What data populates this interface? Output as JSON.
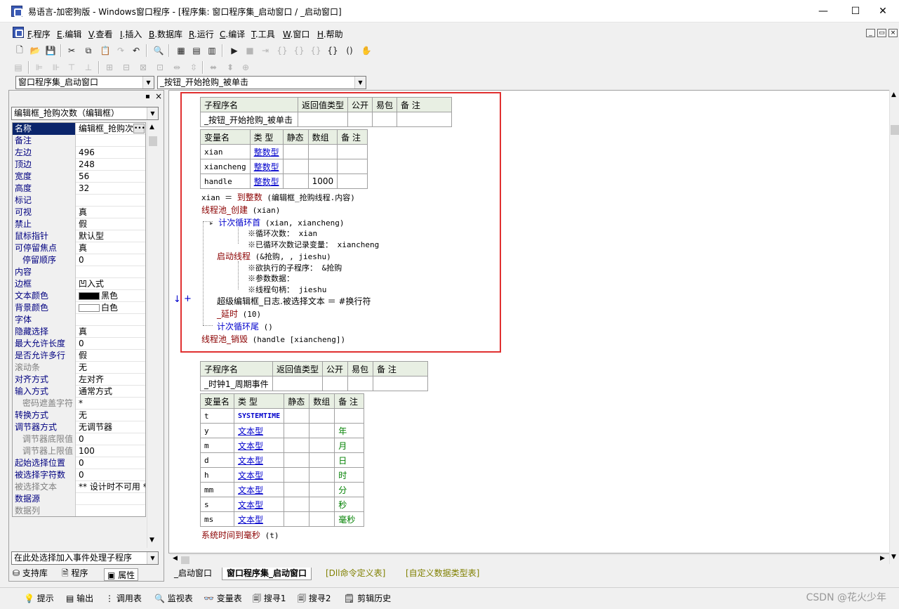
{
  "window": {
    "title": "易语言-加密狗版 - Windows窗口程序 - [程序集: 窗口程序集_启动窗口 / _启动窗口]",
    "min": "—",
    "max": "☐",
    "close": "✕"
  },
  "menu": [
    {
      "key": "F",
      "label": ".程序"
    },
    {
      "key": "E",
      "label": ".编辑"
    },
    {
      "key": "V",
      "label": ".查看"
    },
    {
      "key": "I",
      "label": ".插入"
    },
    {
      "key": "B",
      "label": ".数据库"
    },
    {
      "key": "R",
      "label": ".运行"
    },
    {
      "key": "C",
      "label": ".编译"
    },
    {
      "key": "T",
      "label": ".工具"
    },
    {
      "key": "W",
      "label": ".窗口"
    },
    {
      "key": "H",
      "label": ".帮助"
    }
  ],
  "mdi": {
    "min": "_",
    "restore": "▭",
    "close": "×"
  },
  "toolbar": {
    "assembly_combo": "窗口程序集_启动窗口",
    "sub_combo": "_按钮_开始抢购_被单击"
  },
  "left_panel": {
    "pin": "▪",
    "close": "×",
    "component_combo": "编辑框_抢购次数（编辑框）",
    "properties": [
      {
        "name": "名称",
        "value": "编辑框_抢购次数"
      },
      {
        "name": "备注",
        "value": ""
      },
      {
        "name": "左边",
        "value": "496"
      },
      {
        "name": "顶边",
        "value": "248"
      },
      {
        "name": "宽度",
        "value": "56"
      },
      {
        "name": "高度",
        "value": "32"
      },
      {
        "name": "标记",
        "value": ""
      },
      {
        "name": "可视",
        "value": "真"
      },
      {
        "name": "禁止",
        "value": "假"
      },
      {
        "name": "鼠标指针",
        "value": "默认型"
      },
      {
        "name": "可停留焦点",
        "value": "真"
      },
      {
        "name": "停留顺序",
        "value": "0"
      },
      {
        "name": "内容",
        "value": ""
      },
      {
        "name": "边框",
        "value": "凹入式"
      },
      {
        "name": "文本颜色",
        "value": "黑色"
      },
      {
        "name": "背景颜色",
        "value": "白色"
      },
      {
        "name": "字体",
        "value": ""
      },
      {
        "name": "隐藏选择",
        "value": "真"
      },
      {
        "name": "最大允许长度",
        "value": "0"
      },
      {
        "name": "是否允许多行",
        "value": "假"
      },
      {
        "name": "滚动条",
        "value": "无"
      },
      {
        "name": "对齐方式",
        "value": "左对齐"
      },
      {
        "name": "输入方式",
        "value": "通常方式"
      },
      {
        "name": "密码遮盖字符",
        "value": "*"
      },
      {
        "name": "转换方式",
        "value": "无"
      },
      {
        "name": "调节器方式",
        "value": "无调节器"
      },
      {
        "name": "调节器底限值",
        "value": "0"
      },
      {
        "name": "调节器上限值",
        "value": "100"
      },
      {
        "name": "起始选择位置",
        "value": "0"
      },
      {
        "name": "被选择字符数",
        "value": "0"
      },
      {
        "name": "被选择文本",
        "value": "** 设计时不可用 **"
      },
      {
        "name": "数据源",
        "value": ""
      },
      {
        "name": "数据列",
        "value": ""
      }
    ],
    "event_combo": "在此处选择加入事件处理子程序",
    "tabs": [
      "支持库",
      "程序",
      "属性"
    ]
  },
  "editor": {
    "sub1": {
      "headers": [
        "子程序名",
        "返回值类型",
        "公开",
        "易包",
        "备 注"
      ],
      "name": "_按钮_开始抢购_被单击",
      "var_headers": [
        "变量名",
        "类 型",
        "静态",
        "数组",
        "备 注"
      ],
      "vars": [
        {
          "name": "xian",
          "type": "整数型",
          "arr": ""
        },
        {
          "name": "xiancheng",
          "type": "整数型",
          "arr": ""
        },
        {
          "name": "handle",
          "type": "整数型",
          "arr": "1000"
        }
      ],
      "lines": {
        "l1a": "xian ＝ ",
        "l1b": "到整数",
        "l1c": " (编辑框_抢购线程.内容)",
        "l2a": "线程池_创建",
        "l2b": " (xian)",
        "l3a": "计次循环首",
        "l3b": " (xian, xiancheng)",
        "l4": "※循环次数： xian",
        "l5": "※已循环次数记录变量： xiancheng",
        "l6a": "启动线程",
        "l6b": " (&抢购, , jieshu)",
        "l7": "※欲执行的子程序： &抢购",
        "l8": "※参数数据：",
        "l9": "※线程句柄： jieshu",
        "l10": "超级编辑框_日志.被选择文本 ＝ #换行符",
        "l11a": "_延时",
        "l11b": " (10)",
        "l12a": "计次循环尾",
        "l12b": " ()",
        "l13a": "线程池_销毁",
        "l13b": " (handle [xiancheng])"
      },
      "gutter_arrow": "↓",
      "gutter_plus": "+"
    },
    "sub2": {
      "headers": [
        "子程序名",
        "返回值类型",
        "公开",
        "易包",
        "备 注"
      ],
      "name": "_时钟1_周期事件",
      "var_headers": [
        "变量名",
        "类 型",
        "静态",
        "数组",
        "备 注"
      ],
      "vars": [
        {
          "name": "t",
          "type": "SYSTEMTIME",
          "note": ""
        },
        {
          "name": "y",
          "type": "文本型",
          "note": "年"
        },
        {
          "name": "m",
          "type": "文本型",
          "note": "月"
        },
        {
          "name": "d",
          "type": "文本型",
          "note": "日"
        },
        {
          "name": "h",
          "type": "文本型",
          "note": "时"
        },
        {
          "name": "mm",
          "type": "文本型",
          "note": "分"
        },
        {
          "name": "s",
          "type": "文本型",
          "note": "秒"
        },
        {
          "name": "ms",
          "type": "文本型",
          "note": "毫秒"
        }
      ],
      "line1a": "系统时间到毫秒",
      "line1b": " (t)"
    },
    "tabs": [
      "_启动窗口",
      "窗口程序集_启动窗口",
      "[Dll命令定义表]",
      "[自定义数据类型表]"
    ]
  },
  "statusbar": {
    "tabs": [
      "提示",
      "输出",
      "调用表",
      "监视表",
      "变量表",
      "搜寻1",
      "搜寻2",
      "剪辑历史"
    ]
  },
  "watermark": "CSDN @花火少年",
  "colors": {
    "accent": "#0a246a",
    "highlight_box": "#e03030",
    "keyword": "#8b0000",
    "type_link": "#0000cc",
    "note_green": "#008000"
  }
}
